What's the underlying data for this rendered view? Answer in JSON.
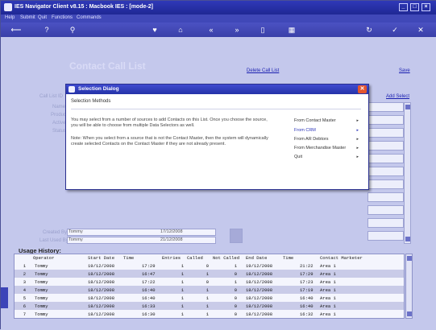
{
  "window": {
    "title": "IES Navigator Client v8.15 : Macbook IES :       [mode-2]"
  },
  "menu": [
    "Help",
    "Submit",
    "Quit",
    "Functions",
    "Commands"
  ],
  "toolbar_icons": [
    "back-icon",
    "help-icon",
    "search-icon",
    "heart-icon",
    "home-icon",
    "rewind-icon",
    "forward-icon",
    "box-icon",
    "grid-icon",
    "refresh-icon",
    "check-icon",
    "close-icon"
  ],
  "form": {
    "title": "Contact Call List",
    "delete_link": "Delete Call List",
    "save_link": "Save",
    "add_select_link": "Add Select",
    "faded_labels": [
      "Call List ID",
      "Name",
      "Product",
      "Active",
      "Status"
    ],
    "created_by_label": "Created By",
    "created_by_value": "Tommy",
    "created_date": "17/12/2008",
    "last_used_label": "Last Used By",
    "last_used_value": "Tommy",
    "last_used_date": "21/12/2008"
  },
  "dialog": {
    "title": "Selection Dialog",
    "subtitle": "Selection Methods",
    "para1_line1": "You may select from a number of sources to add Contacts on this List. Once you choose the source,",
    "para1_line2": "you will be able to choose from multiple Data Selectors as well.",
    "para2_line1": "Note: When you select from a source that is not the Contact Master, then the system will dynamically",
    "para2_line2": "create selected Contacts on the Contact Master if they are not already present.",
    "options": [
      "From Contact Master",
      "From CRM",
      "From AR Debtors",
      "From Merchandise Master",
      "Quit"
    ],
    "arrow": "▸"
  },
  "usage": {
    "title": "Usage History:",
    "columns": [
      "Operator",
      "Start Date",
      "Time",
      "Entries",
      "Called",
      "Not Called",
      "End Date",
      "Time",
      "Contact Marketer"
    ],
    "rows": [
      [
        "1",
        "Tommy",
        "19/12/2008",
        "17:29",
        "1",
        "0",
        "1",
        "19/12/2008",
        "21:22",
        "Area 1"
      ],
      [
        "2",
        "Tommy",
        "18/12/2008",
        "16:47",
        "1",
        "1",
        "0",
        "18/12/2008",
        "17:29",
        "Area 1"
      ],
      [
        "3",
        "Tommy",
        "18/12/2008",
        "17:22",
        "1",
        "0",
        "1",
        "18/12/2008",
        "17:23",
        "Area 1"
      ],
      [
        "4",
        "Tommy",
        "18/12/2008",
        "16:40",
        "1",
        "1",
        "0",
        "18/12/2008",
        "17:19",
        "Area 1"
      ],
      [
        "5",
        "Tommy",
        "18/12/2008",
        "16:40",
        "1",
        "1",
        "0",
        "18/12/2008",
        "16:40",
        "Area 1"
      ],
      [
        "6",
        "Tommy",
        "18/12/2008",
        "16:33",
        "1",
        "1",
        "0",
        "18/12/2008",
        "16:40",
        "Area 1"
      ],
      [
        "7",
        "Tommy",
        "18/12/2008",
        "16:30",
        "1",
        "1",
        "0",
        "18/12/2008",
        "16:32",
        "Area 1"
      ]
    ]
  },
  "colors": {
    "title_bar": "#2f39b8",
    "row_alt": "#c9cbe8",
    "row_base": "#f4f5fd",
    "dialog_close": "#e3552e"
  }
}
